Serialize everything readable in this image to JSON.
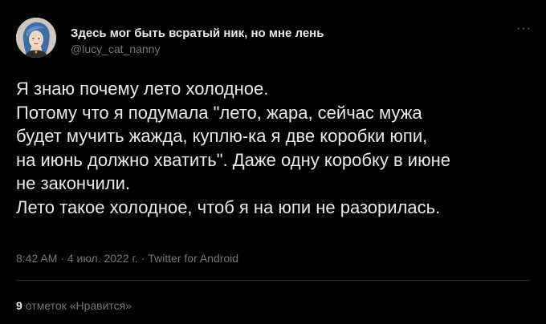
{
  "author": {
    "display_name": "Здесь мог быть всратый ник, но мне лень",
    "handle": "@lucy_cat_nanny",
    "avatar_icon": "user-avatar-photo"
  },
  "more_label": "···",
  "tweet": {
    "lines": [
      "Я знаю почему лето холодное.",
      "Потому что я подумала \"лето, жара, сейчас мужа",
      "будет мучить жажда, куплю-ка я две коробки юпи,",
      "на июнь должно хватить\". Даже одну коробку в июне",
      "не закончили.",
      "Лето такое холодное, чтоб я на юпи не разорилась."
    ]
  },
  "meta": {
    "time": "8:42 AM",
    "separator": " · ",
    "date": "4 июл. 2022 г.",
    "source": "Twitter for Android"
  },
  "likes": {
    "count": "9",
    "label": "отметок «Нравится»"
  },
  "colors": {
    "background": "#000000",
    "text": "#e7e9ea",
    "secondary": "#71767b",
    "divider": "#2f3336"
  }
}
